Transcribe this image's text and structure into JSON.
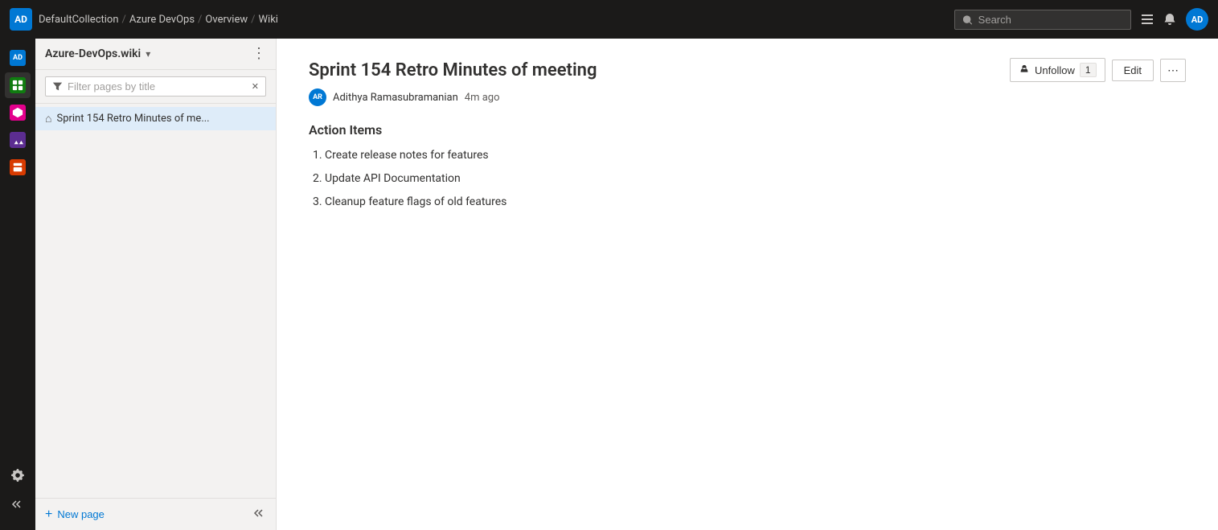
{
  "topNav": {
    "logo": "AD",
    "breadcrumbs": [
      {
        "label": "DefaultCollection"
      },
      {
        "label": "Azure DevOps"
      },
      {
        "label": "Overview"
      },
      {
        "label": "Wiki"
      }
    ],
    "search": {
      "placeholder": "Search"
    },
    "userInitials": "AD"
  },
  "sidebar": {
    "title": "Azure-DevOps.wiki",
    "filterPlaceholder": "Filter pages by title",
    "pages": [
      {
        "label": "Sprint 154 Retro Minutes of me...",
        "active": true
      }
    ],
    "newPageLabel": "New page"
  },
  "page": {
    "title": "Sprint 154 Retro Minutes of meeting",
    "authorInitials": "AR",
    "authorName": "Adithya Ramasubramanian",
    "timeAgo": "4m ago",
    "unfollowLabel": "Unfollow",
    "followCount": "1",
    "editLabel": "Edit",
    "sectionTitle": "Action Items",
    "actionItems": [
      "Create release notes for features",
      "Update API Documentation",
      "Cleanup feature flags of old features"
    ]
  },
  "iconBar": {
    "items": [
      {
        "icon": "AD",
        "color": "#0078d4",
        "label": "home"
      },
      {
        "icon": "✓",
        "color": "#107c10",
        "label": "boards"
      },
      {
        "icon": "⚙",
        "color": "#e3008c",
        "label": "pipelines"
      },
      {
        "icon": "🧪",
        "color": "#5c2d91",
        "label": "test"
      },
      {
        "icon": "📦",
        "color": "#d83b01",
        "label": "artifacts"
      }
    ],
    "bottomItems": [
      {
        "icon": "⚙",
        "label": "settings"
      }
    ]
  }
}
